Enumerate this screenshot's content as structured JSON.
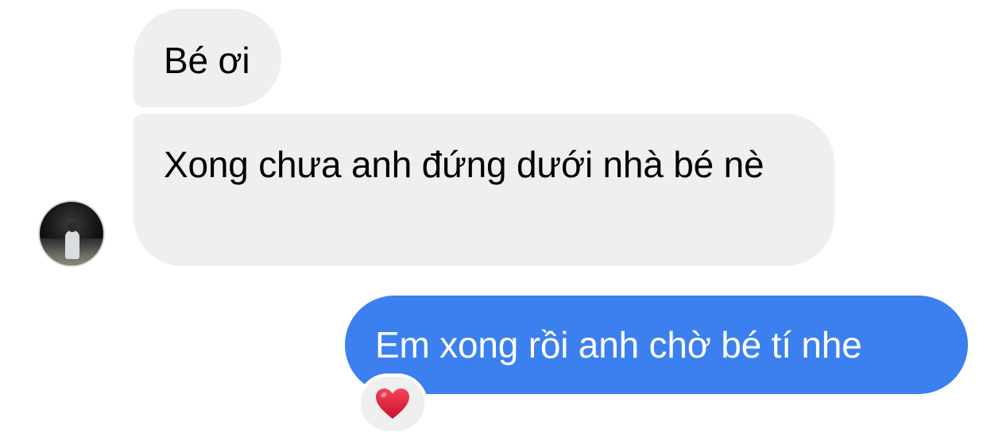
{
  "messages": [
    {
      "direction": "incoming",
      "text": "Bé ơi"
    },
    {
      "direction": "incoming",
      "text": "Xong chưa anh đứng dưới nhà bé nè"
    },
    {
      "direction": "outgoing",
      "text": "Em xong rồi anh chờ bé tí nhe"
    }
  ],
  "reaction": {
    "icon": "heart-icon",
    "color": "#e0182e"
  },
  "colors": {
    "incoming_bubble": "#efefef",
    "outgoing_bubble": "#3b80ee",
    "outgoing_text": "#ffffff"
  }
}
